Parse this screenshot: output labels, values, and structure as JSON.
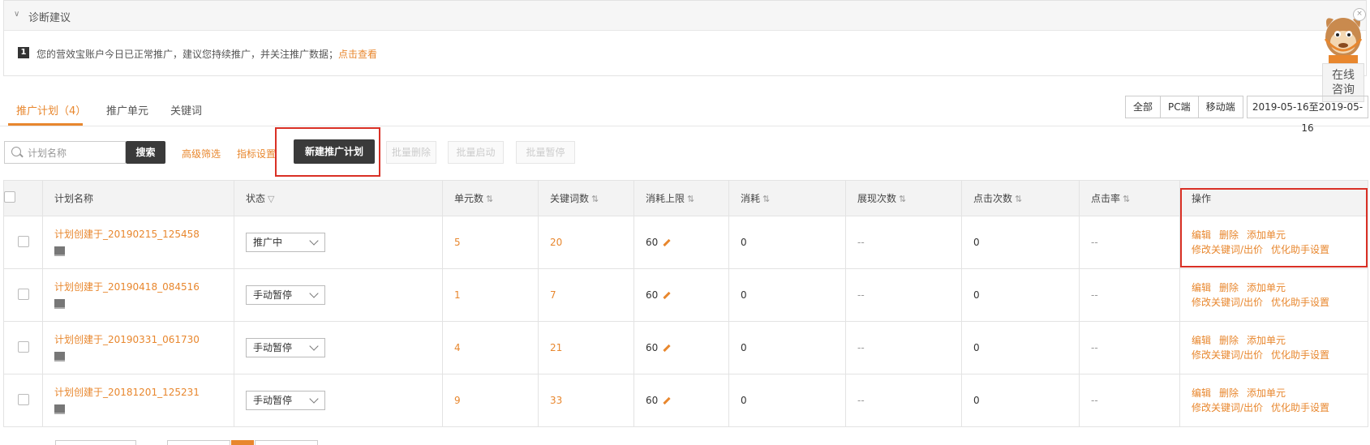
{
  "diagnosis": {
    "title": "诊断建议",
    "index": "1",
    "message": "您的营效宝账户今日已正常推广，建议您持续推广，并关注推广数据；",
    "link": "点击查看"
  },
  "assistant": {
    "line1": "在线",
    "line2": "咨询",
    "close": "×"
  },
  "tabs": [
    {
      "label": "推广计划（4）",
      "active": true
    },
    {
      "label": "推广单元"
    },
    {
      "label": "关键词"
    }
  ],
  "device_filter": [
    "全部",
    "PC端",
    "移动端"
  ],
  "date_range": "2019-05-16至2019-05-16",
  "toolbar": {
    "search_placeholder": "计划名称",
    "search_button": "搜索",
    "advanced_filter": "高级筛选",
    "metric_settings": "指标设置",
    "new_plan": "新建推广计划",
    "bulk_delete": "批量删除",
    "bulk_start": "批量启动",
    "bulk_pause": "批量暂停"
  },
  "table": {
    "headers": [
      "计划名称",
      "状态",
      "单元数",
      "关键词数",
      "消耗上限",
      "消耗",
      "展现次数",
      "点击次数",
      "点击率",
      "操作"
    ],
    "sort_icon": "⇅",
    "rows": [
      {
        "name": "计划创建于_20190215_125458",
        "status": "推广中",
        "units": "5",
        "keywords": "20",
        "limit": "60",
        "cost": "0",
        "impressions": "--",
        "clicks": "0",
        "ctr": "--"
      },
      {
        "name": "计划创建于_20190418_084516",
        "status": "手动暂停",
        "units": "1",
        "keywords": "7",
        "limit": "60",
        "cost": "0",
        "impressions": "--",
        "clicks": "0",
        "ctr": "--"
      },
      {
        "name": "计划创建于_20190331_061730",
        "status": "手动暂停",
        "units": "4",
        "keywords": "21",
        "limit": "60",
        "cost": "0",
        "impressions": "--",
        "clicks": "0",
        "ctr": "--"
      },
      {
        "name": "计划创建于_20181201_125231",
        "status": "手动暂停",
        "units": "9",
        "keywords": "33",
        "limit": "60",
        "cost": "0",
        "impressions": "--",
        "clicks": "0",
        "ctr": "--"
      }
    ],
    "ops": {
      "edit": "编辑",
      "delete": "删除",
      "add_unit": "添加单元",
      "modify_bid": "修改关键词/出价",
      "optimize": "优化助手设置"
    }
  },
  "colors": {
    "accent": "#e8872e",
    "highlight": "#d93025",
    "dark_button": "#3a3a3a"
  }
}
